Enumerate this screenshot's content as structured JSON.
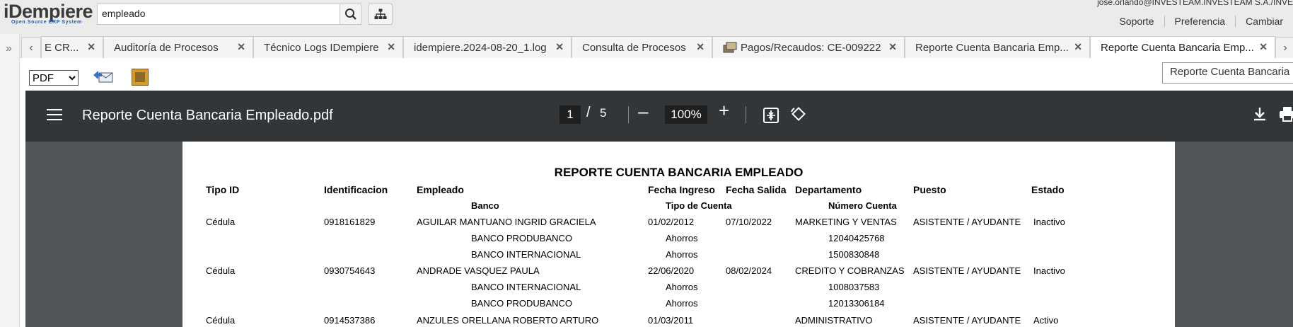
{
  "app": {
    "logo_text": "iDempiere",
    "logo_tagline": "Open Source ERP System",
    "search_value": "empleado",
    "user": "jose.orlando@INVESTEAM.INVESTEAM S.A./INVE",
    "links": [
      "Soporte",
      "Preferencia",
      "Cambiar"
    ]
  },
  "tabs": [
    {
      "label": "E CR..."
    },
    {
      "label": "Auditoría de Procesos"
    },
    {
      "label": "Técnico Logs IDempiere"
    },
    {
      "label": "idempiere.2024-08-20_1.log"
    },
    {
      "label": "Consulta de Procesos"
    },
    {
      "label": "Pagos/Recaudos: CE-009222"
    },
    {
      "label": "Reporte Cuenta Bancaria Emp..."
    },
    {
      "label": "Reporte Cuenta Bancaria Emp..."
    }
  ],
  "toolbar": {
    "format_value": "PDF",
    "tooltip": "Reporte Cuenta Bancaria Empleado.pdf"
  },
  "viewer": {
    "filename": "Reporte Cuenta Bancaria Empleado.pdf",
    "page_current": "1",
    "page_sep": "/",
    "page_total": "5",
    "zoom": "100%"
  },
  "report": {
    "title": "REPORTE CUENTA BANCARIA EMPLEADO",
    "headers": {
      "tipo_id": "Tipo ID",
      "identificacion": "Identificacion",
      "empleado": "Empleado",
      "fecha_ingreso": "Fecha Ingreso",
      "fecha_salida": "Fecha Salida",
      "departamento": "Departamento",
      "puesto": "Puesto",
      "estado": "Estado",
      "banco": "Banco",
      "tipo_cuenta": "Tipo de Cuenta",
      "numero_cuenta": "Número Cuenta"
    },
    "employees": [
      {
        "tipo_id": "Cédula",
        "identificacion": "0918161829",
        "empleado": "AGUILAR MANTUANO INGRID GRACIELA",
        "fecha_ingreso": "01/02/2012",
        "fecha_salida": "07/10/2022",
        "departamento": "MARKETING Y VENTAS",
        "puesto": "ASISTENTE / AYUDANTE",
        "estado": "Inactivo",
        "accounts": [
          {
            "banco": "BANCO PRODUBANCO",
            "tipo": "Ahorros",
            "numero": "12040425768"
          },
          {
            "banco": "BANCO INTERNACIONAL",
            "tipo": "Ahorros",
            "numero": "1500830848"
          }
        ]
      },
      {
        "tipo_id": "Cédula",
        "identificacion": "0930754643",
        "empleado": "ANDRADE VASQUEZ PAULA",
        "fecha_ingreso": "22/06/2020",
        "fecha_salida": "08/02/2024",
        "departamento": "CREDITO Y COBRANZAS",
        "puesto": "ASISTENTE / AYUDANTE",
        "estado": "Inactivo",
        "accounts": [
          {
            "banco": "BANCO INTERNACIONAL",
            "tipo": "Ahorros",
            "numero": "1008037583"
          },
          {
            "banco": "BANCO PRODUBANCO",
            "tipo": "Ahorros",
            "numero": "12013306184"
          }
        ]
      },
      {
        "tipo_id": "Cédula",
        "identificacion": "0914537386",
        "empleado": "ANZULES ORELLANA ROBERTO ARTURO",
        "fecha_ingreso": "01/03/2011",
        "fecha_salida": "",
        "departamento": "ADMINISTRATIVO",
        "puesto": "ASISTENTE / AYUDANTE",
        "estado": "Activo",
        "accounts": []
      }
    ]
  }
}
